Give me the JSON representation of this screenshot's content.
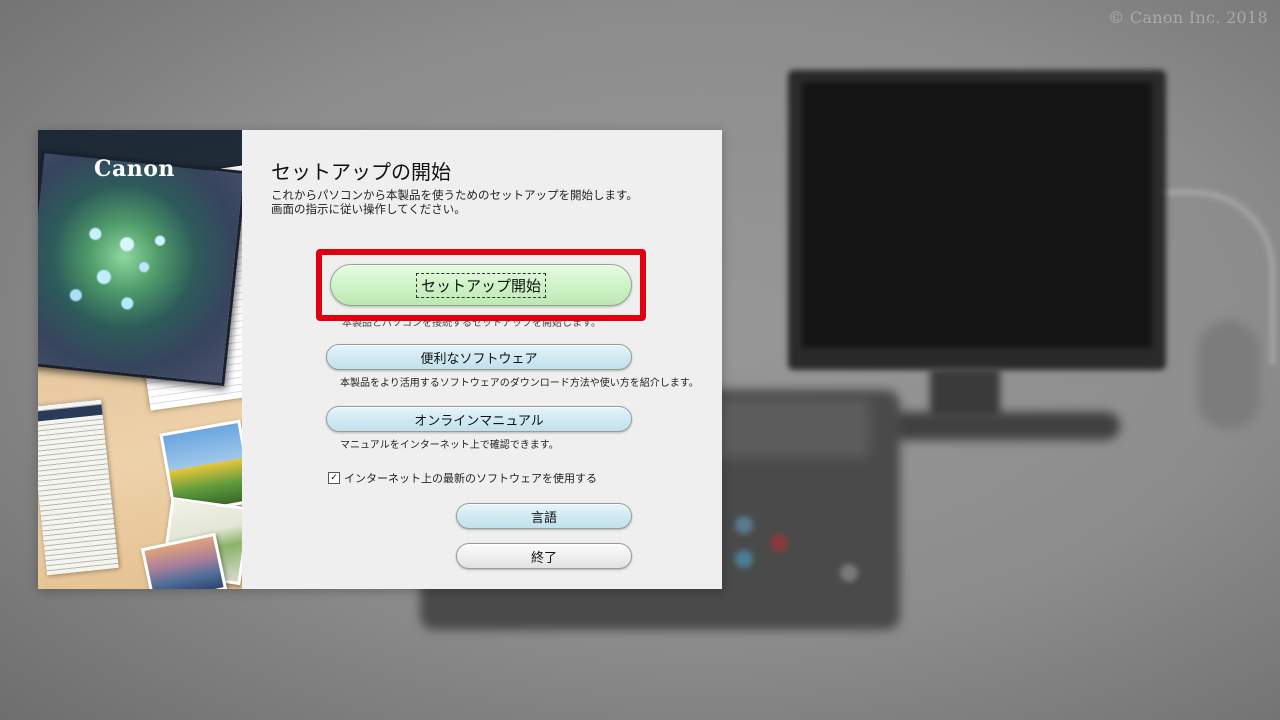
{
  "watermark": "© Canon Inc. 2018",
  "brand": {
    "logo_text": "Canon"
  },
  "dialog": {
    "title": "セットアップの開始",
    "description_lines": [
      "これからパソコンから本製品を使うためのセットアップを開始します。",
      "画面の指示に従い操作してください。"
    ],
    "setup_button": {
      "label": "セットアップ開始"
    },
    "setup_hint": "本製品とパソコンを接続するセットアップを開始します。",
    "software_button": {
      "label": "便利なソフトウェア"
    },
    "software_hint": "本製品をより活用するソフトウェアのダウンロード方法や使い方を紹介します。",
    "manual_button": {
      "label": "オンラインマニュアル"
    },
    "manual_hint": "マニュアルをインターネット上で確認できます。",
    "checkbox": {
      "checked": true,
      "mark": "✓",
      "label": "インターネット上の最新のソフトウェアを使用する"
    },
    "language_button": {
      "label": "言語"
    },
    "exit_button": {
      "label": "終了"
    }
  },
  "colors": {
    "highlight": "#e0000e",
    "primary_button": "#cdf2c6",
    "secondary_button": "#cfe9f2"
  }
}
